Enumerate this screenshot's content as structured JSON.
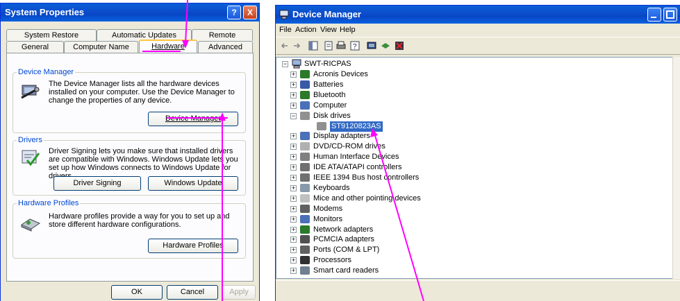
{
  "colors": {
    "accent": "#ff00ff",
    "titlebar": "#0a5fd6",
    "selection": "#316ac5"
  },
  "system_properties": {
    "title": "System Properties",
    "help_button": "?",
    "close_button": "X",
    "tabs_row1": [
      "System Restore",
      "Automatic Updates",
      "Remote"
    ],
    "tabs_row2": [
      "General",
      "Computer Name",
      "Hardware",
      "Advanced"
    ],
    "active_tab": "Hardware",
    "device_manager_group": {
      "label": "Device Manager",
      "text": "The Device Manager lists all the hardware devices installed on your computer. Use the Device Manager to change the properties of any device.",
      "button": "Device Manager"
    },
    "drivers_group": {
      "label": "Drivers",
      "text": "Driver Signing lets you make sure that installed drivers are compatible with Windows. Windows Update lets you set up how Windows connects to Windows Update for drivers.",
      "button_signing": "Driver Signing",
      "button_update": "Windows Update"
    },
    "hardware_profiles_group": {
      "label": "Hardware Profiles",
      "text": "Hardware profiles provide a way for you to set up and store different hardware configurations.",
      "button": "Hardware Profiles"
    },
    "ok": "OK",
    "cancel": "Cancel",
    "apply": "Apply"
  },
  "device_manager": {
    "title": "Device Manager",
    "menu": [
      "File",
      "Action",
      "View",
      "Help"
    ],
    "computer_name": "SWT-RICPAS",
    "tree": [
      {
        "label": "Acronis Devices",
        "icon": "device-icon",
        "expander": "+"
      },
      {
        "label": "Batteries",
        "icon": "battery-icon",
        "expander": "+"
      },
      {
        "label": "Bluetooth",
        "icon": "bluetooth-icon",
        "expander": "+"
      },
      {
        "label": "Computer",
        "icon": "computer-icon",
        "expander": "+"
      },
      {
        "label": "Disk drives",
        "icon": "disk-drive-icon",
        "expander": "-"
      },
      {
        "label": "ST9120823AS",
        "icon": "disk-drive-icon",
        "expander": "",
        "child": true,
        "selected": true
      },
      {
        "label": "Display adapters",
        "icon": "monitor-icon",
        "expander": "+"
      },
      {
        "label": "DVD/CD-ROM drives",
        "icon": "cd-icon",
        "expander": "+"
      },
      {
        "label": "Human Interface Devices",
        "icon": "hid-icon",
        "expander": "+"
      },
      {
        "label": "IDE ATA/ATAPI controllers",
        "icon": "ide-icon",
        "expander": "+"
      },
      {
        "label": "IEEE 1394 Bus host controllers",
        "icon": "firewire-icon",
        "expander": "+"
      },
      {
        "label": "Keyboards",
        "icon": "keyboard-icon",
        "expander": "+"
      },
      {
        "label": "Mice and other pointing devices",
        "icon": "mouse-icon",
        "expander": "+"
      },
      {
        "label": "Modems",
        "icon": "modem-icon",
        "expander": "+"
      },
      {
        "label": "Monitors",
        "icon": "monitor-icon",
        "expander": "+"
      },
      {
        "label": "Network adapters",
        "icon": "network-icon",
        "expander": "+"
      },
      {
        "label": "PCMCIA adapters",
        "icon": "pcmcia-icon",
        "expander": "+"
      },
      {
        "label": "Ports (COM & LPT)",
        "icon": "port-icon",
        "expander": "+"
      },
      {
        "label": "Processors",
        "icon": "processor-icon",
        "expander": "+"
      },
      {
        "label": "Smart card readers",
        "icon": "smartcard-icon",
        "expander": "+"
      }
    ]
  }
}
